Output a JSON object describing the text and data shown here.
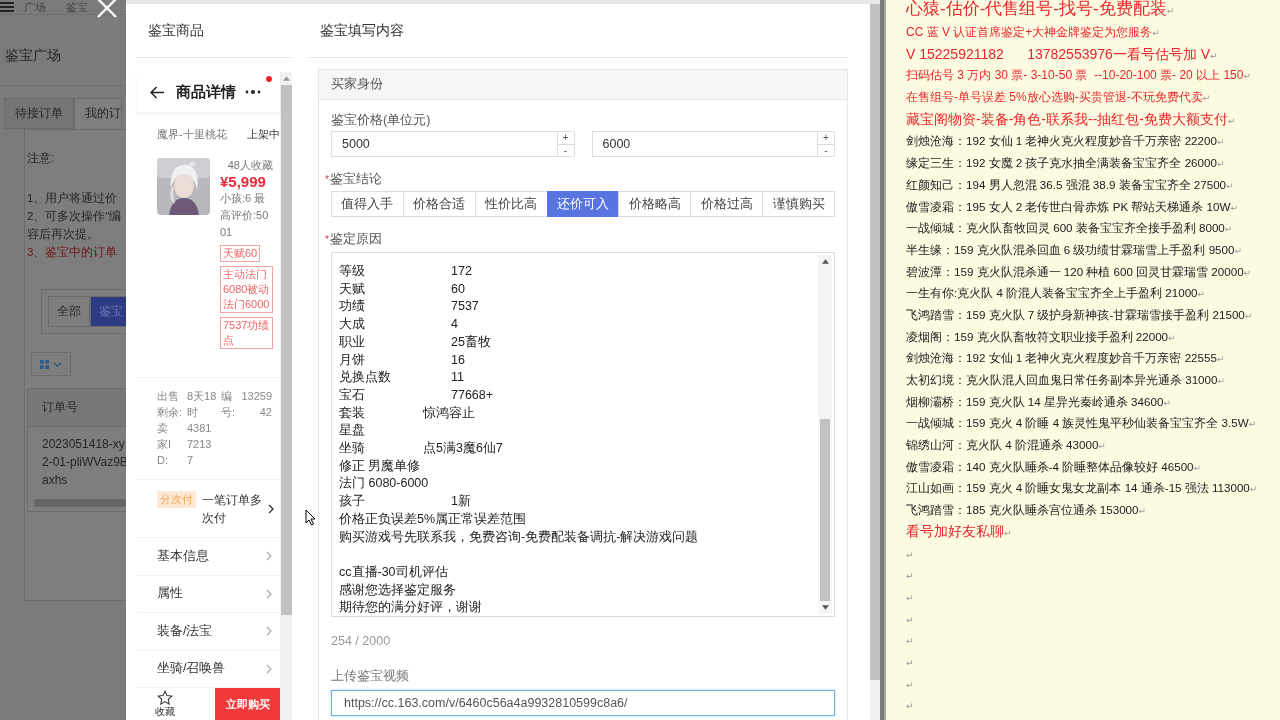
{
  "background_page": {
    "breadcrumb": [
      "广场",
      "鉴宝"
    ],
    "page_title": "鉴宝广场",
    "tabs": [
      {
        "label": "待接订单",
        "selected": false
      },
      {
        "label": "我的订",
        "selected": true
      }
    ],
    "notice": {
      "title": "注意:",
      "lines": [
        {
          "kind": "plain",
          "text": "1、用户将通过价"
        },
        {
          "kind": "plain",
          "text": "2、可多次操作“编"
        },
        {
          "kind": "plain",
          "text": "容后再次提。"
        },
        {
          "kind": "warning",
          "text": "3、鉴宝中的订单"
        }
      ]
    },
    "filters": [
      {
        "label": "全部",
        "selected": false
      },
      {
        "label": "鉴宝",
        "selected": true
      }
    ],
    "table": {
      "columns": [
        "订单号"
      ],
      "rows": [
        [
          "2023051418-xy2-01-pliWVaz9Baxhs"
        ]
      ]
    }
  },
  "modal": {
    "left_title": "鉴宝商品",
    "right_title": "鉴宝填写内容"
  },
  "product": {
    "title": "商品详情",
    "has_notification": true,
    "server": "魔界-十里桃花",
    "status": "上架中",
    "favorites": "48人收藏",
    "price": "¥5,999",
    "summary": "小孩:6 最高评价:5001",
    "tags": [
      "天赋60",
      "主动法门6080被动法门6000",
      "7537功绩点"
    ],
    "info": [
      {
        "label": "出售剩余:",
        "value": "8天18时"
      },
      {
        "label": "编号:",
        "value": "1325942"
      },
      {
        "label": "卖家ID:",
        "value": "438172137"
      }
    ],
    "installment": {
      "badge": "分次付",
      "text": "一笔订单多次付"
    },
    "menu": [
      "基本信息",
      "属性",
      "装备/法宝",
      "坐骑/召唤兽"
    ],
    "favorite_label": "收藏",
    "buy_label": "立即购买"
  },
  "form": {
    "section": "买家身份",
    "price_label": "鉴宝价格(单位元)",
    "price_inputs": [
      "5000",
      "6000"
    ],
    "increment": "+",
    "decrement": "-",
    "required_mark": "*",
    "conclusion_label": "鉴宝结论",
    "conclusion_options": [
      {
        "label": "值得入手",
        "selected": false
      },
      {
        "label": "价格合适",
        "selected": false
      },
      {
        "label": "性价比高",
        "selected": false
      },
      {
        "label": "还价可入",
        "selected": true
      },
      {
        "label": "价格略高",
        "selected": false
      },
      {
        "label": "价格过高",
        "selected": false
      },
      {
        "label": "谨慎购买",
        "selected": false
      }
    ],
    "reason_label": "鉴定原因",
    "reason_paragraphs": [
      [
        "等级\t\t\t\t172",
        "天赋\t\t\t\t60",
        "功绩\t\t\t\t7537",
        "大成\t\t\t\t4",
        "职业\t\t\t\t25畜牧",
        "月饼\t\t\t\t16",
        "兑换点数\t\t\t11",
        "宝石\t\t\t\t77668+",
        "套装\t\t\t惊鸿容止",
        "星盘",
        "坐骑\t\t\t点5满3魔6仙7",
        "修正 男魔单修",
        "法门 6080-6000",
        "孩子\t\t\t\t1新",
        "价格正负误差5%属正常误差范围",
        "购买游戏号先联系我，免费咨询-免费配装备调抗-解决游戏问题"
      ],
      [
        "cc直播-30司机评估",
        "感谢您选择鉴定服务",
        "期待您的满分好评，谢谢"
      ]
    ],
    "counter": "254 / 2000",
    "video_label": "上传鉴宝视频",
    "video_url": "https://cc.163.com/v/6460c56a4a9932810599c8a6/",
    "video_focused": true
  },
  "notes": [
    {
      "kind": "headline",
      "text": "心猿-估价-代售组号-找号-免费配装",
      "end_mark": "↵"
    },
    {
      "kind": "red",
      "text": "CC 蓝 V 认证首席鉴定+大神金牌鉴定为您服务",
      "end_mark": "↵"
    },
    {
      "kind": "phone",
      "text": "V 15225921182      13782553976一看号估号加 V",
      "end_mark": "↵"
    },
    {
      "kind": "red",
      "text": "扫码估号 3 万内 30 票- 3-10-50 票  --10-20-100 票- 20 以上 150",
      "end_mark": "↵"
    },
    {
      "kind": "red",
      "text": "在售组号-单号误差 5%放心选购-买贵管退-不玩免费代卖",
      "end_mark": "↵"
    },
    {
      "kind": "redbig",
      "text": "藏宝阁物资-装备-角色-联系我--抽红包-免费大额支付",
      "end_mark": "↵"
    },
    {
      "kind": "plain",
      "text": "剑烛沧海：192 女仙 1 老神火克火程度妙音千万亲密 22200",
      "end_mark": "↵"
    },
    {
      "kind": "plain",
      "text": "缘定三生：192 女魔 2 孩子克水抽全满装备宝宝齐全 26000",
      "end_mark": "↵"
    },
    {
      "kind": "plain",
      "text": "红颜知己：194 男人忽混 36.5 强混 38.9 装备宝宝齐全 27500",
      "end_mark": "↵"
    },
    {
      "kind": "plain",
      "text": "傲雪凌霜：195 女人 2 老传世白骨赤炼 PK 帮站天梯通杀 10W",
      "end_mark": "↵"
    },
    {
      "kind": "plain",
      "text": "一战倾城：克火队畜牧回灵 600 装备宝宝齐全接手盈利 8000",
      "end_mark": "↵"
    },
    {
      "kind": "plain",
      "text": "半生缘：159 克火队混杀回血 6 级功绩甘霖瑞雪上手盈利 9500",
      "end_mark": "↵"
    },
    {
      "kind": "plain",
      "text": "碧波潭：159 克火队混杀通一 120 种植 600 回灵甘霖瑞雪 20000",
      "end_mark": "↵"
    },
    {
      "kind": "plain",
      "text": "一生有你:克火队 4 阶混人装备宝宝齐全上手盈利 21000",
      "end_mark": "↵"
    },
    {
      "kind": "plain",
      "text": "飞鸿踏雪：159 克火队 7 级护身新神孩-甘霖瑞雪接手盈利 21500",
      "end_mark": "↵"
    },
    {
      "kind": "plain",
      "text": "凌烟阁：159 克火队畜牧符文职业接手盈利 22000",
      "end_mark": "↵"
    },
    {
      "kind": "plain",
      "text": "剑烛沧海：192 女仙 1 老神火克火程度妙音千万亲密 22555",
      "end_mark": "↵"
    },
    {
      "kind": "plain",
      "text": "太初幻境：克火队混人回血鬼日常任务副本异光通杀 31000",
      "end_mark": "↵"
    },
    {
      "kind": "plain",
      "text": "烟柳灞桥：159 克火队 14 星异光秦岭通杀 34600",
      "end_mark": "↵"
    },
    {
      "kind": "plain",
      "text": "一战倾城：159 克火 4 阶睡 4 族灵性鬼平秒仙装备宝宝齐全 3.5W",
      "end_mark": "↵"
    },
    {
      "kind": "plain",
      "text": "锦绣山河：克火队 4 阶混通杀 43000",
      "end_mark": "↵"
    },
    {
      "kind": "plain",
      "text": "傲雪凌霜：140 克火队睡杀-4 阶睡整体品像较好 46500",
      "end_mark": "↵"
    },
    {
      "kind": "plain",
      "text": "江山如画：159 克火 4 阶睡女鬼女龙副本 14 通杀-15 强法 113000",
      "end_mark": "↵"
    },
    {
      "kind": "plain",
      "text": "飞鸿踏雪：185 克火队睡杀宫位通杀 153000",
      "end_mark": "↵"
    },
    {
      "kind": "redbig",
      "text": "看号加好友私聊",
      "end_mark": "↵"
    },
    {
      "kind": "blank",
      "end_mark": "↵"
    },
    {
      "kind": "blank",
      "end_mark": "↵"
    },
    {
      "kind": "blank",
      "end_mark": "↵"
    },
    {
      "kind": "blank",
      "end_mark": "↵"
    },
    {
      "kind": "blank",
      "end_mark": "↵"
    },
    {
      "kind": "blank",
      "end_mark": "↵"
    },
    {
      "kind": "blank",
      "end_mark": "↵"
    },
    {
      "kind": "blank",
      "end_mark": "↵"
    }
  ]
}
